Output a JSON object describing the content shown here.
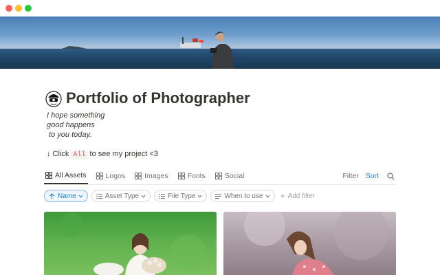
{
  "page": {
    "title": "Portfolio of Photographer",
    "icon": "photographer-avatar-icon",
    "quote_lines": [
      "I hope something",
      "good happens",
      " to you today."
    ],
    "hint": {
      "prefix": "↓ Click ",
      "code": "All",
      "suffix": " to see my project <3"
    }
  },
  "tabs": [
    {
      "label": "All Assets",
      "icon": "grid-icon",
      "active": true
    },
    {
      "label": "Logos",
      "icon": "grid-icon",
      "active": false
    },
    {
      "label": "Images",
      "icon": "grid-icon",
      "active": false
    },
    {
      "label": "Fonts",
      "icon": "grid-icon",
      "active": false
    },
    {
      "label": "Social",
      "icon": "grid-icon",
      "active": false
    }
  ],
  "toolbar": {
    "filter_label": "Filter",
    "sort_label": "Sort"
  },
  "filters": {
    "chips": [
      {
        "label": "Name",
        "icon": "arrow-up-icon",
        "selected": true
      },
      {
        "label": "Asset Type",
        "icon": "list-icon",
        "selected": false
      },
      {
        "label": "File Type",
        "icon": "list-icon",
        "selected": false
      },
      {
        "label": "When to use",
        "icon": "text-lines-icon",
        "selected": false
      }
    ],
    "add_label": "Add filter"
  },
  "colors": {
    "accent": "#2383e2",
    "text": "#37352f",
    "muted": "#73716c",
    "code": "#eb5757"
  }
}
